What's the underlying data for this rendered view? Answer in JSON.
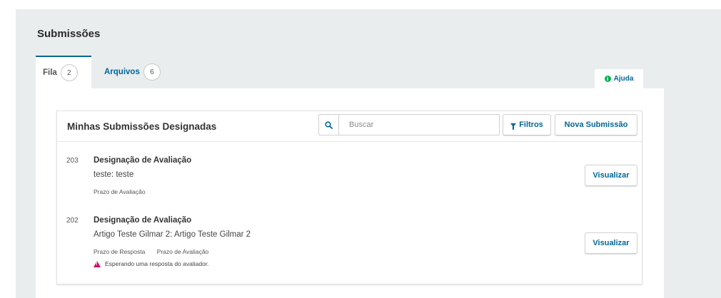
{
  "header": {
    "title": "Submissões"
  },
  "tabs": [
    {
      "label": "Fila",
      "count": "2",
      "active": true
    },
    {
      "label": "Arquivos",
      "count": "6",
      "active": false
    }
  ],
  "help": {
    "label": "Ajuda",
    "icon": "info-icon",
    "icon_color": "#00b24e"
  },
  "list": {
    "title": "Minhas Submissões Designadas",
    "search": {
      "placeholder": "Buscar",
      "icon": "search-icon"
    },
    "filters_label": "Filtros",
    "new_submission_label": "Nova Submissão",
    "items": [
      {
        "id": "203",
        "type": "Designação de Avaliação",
        "title": "teste: teste",
        "meta": [
          "Prazo de Avaliação"
        ],
        "warning": "",
        "action": "Visualizar"
      },
      {
        "id": "202",
        "type": "Designação de Avaliação",
        "title": "Artigo Teste Gilmar 2: Artigo Teste Gilmar 2",
        "meta": [
          "Prazo de Resposta",
          "Prazo de Avaliação"
        ],
        "warning": "Esperando uma resposta do avaliador.",
        "action": "Visualizar"
      }
    ]
  },
  "colors": {
    "accent": "#006798",
    "warning": "#d00a6c",
    "background": "#eaedee"
  }
}
